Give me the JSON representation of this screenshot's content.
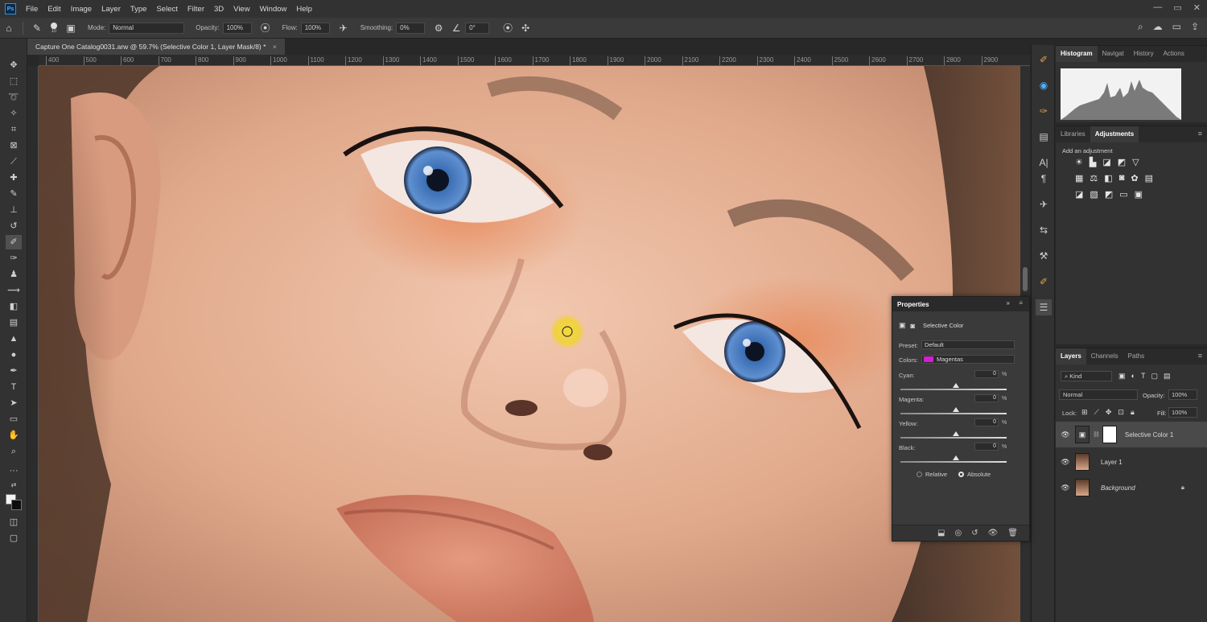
{
  "menubar": {
    "logo": "Ps",
    "items": [
      "File",
      "Edit",
      "Image",
      "Layer",
      "Type",
      "Select",
      "Filter",
      "3D",
      "View",
      "Window",
      "Help"
    ],
    "window_controls": [
      "—",
      "▭",
      "✕"
    ]
  },
  "options": {
    "brush_size": "10",
    "mode_label": "Mode:",
    "mode_value": "Normal",
    "opacity_label": "Opacity:",
    "opacity_value": "100%",
    "flow_label": "Flow:",
    "flow_value": "100%",
    "smoothing_label": "Smoothing:",
    "smoothing_value": "0%",
    "angle_value": "0°"
  },
  "document": {
    "tab_title": "Capture One Catalog0031.arw @ 59.7% (Selective Color 1, Layer Mask/8) *",
    "close": "×"
  },
  "ruler": {
    "ticks": [
      "400",
      "500",
      "600",
      "700",
      "800",
      "900",
      "1000",
      "1100",
      "1200",
      "1300",
      "1400",
      "1500",
      "1600",
      "1700",
      "1800",
      "1900",
      "2000",
      "2100",
      "2200",
      "2300",
      "2400",
      "2500",
      "2600",
      "2700",
      "2800",
      "2900"
    ]
  },
  "histogram_panel": {
    "tabs": [
      "Histogram",
      "Navigat",
      "History",
      "Actions"
    ],
    "active": "Histogram",
    "warning": "⚠"
  },
  "adjustments_panel": {
    "tabs": [
      "Libraries",
      "Adjustments"
    ],
    "active": "Adjustments",
    "hint": "Add an adjustment"
  },
  "properties": {
    "title": "Properties",
    "layer_type": "Selective Color",
    "preset_label": "Preset:",
    "preset_value": "Default",
    "colors_label": "Colors:",
    "colors_value": "Magentas",
    "colors_swatch": "#d21fd2",
    "sliders": [
      {
        "label": "Cyan:",
        "value": "0",
        "unit": "%"
      },
      {
        "label": "Magenta:",
        "value": "0",
        "unit": "%"
      },
      {
        "label": "Yellow:",
        "value": "0",
        "unit": "%"
      },
      {
        "label": "Black:",
        "value": "0",
        "unit": "%"
      }
    ],
    "method_relative": "Relative",
    "method_absolute": "Absolute",
    "method_selected": "Absolute"
  },
  "layers_panel": {
    "tabs": [
      "Layers",
      "Channels",
      "Paths"
    ],
    "active": "Layers",
    "kind_label": "Kind",
    "blend_mode": "Normal",
    "opacity_label": "Opacity:",
    "opacity_value": "100%",
    "lock_label": "Lock:",
    "fill_label": "Fill:",
    "fill_value": "100%",
    "layers": [
      {
        "name": "Selective Color 1",
        "selected": true
      },
      {
        "name": "Layer 1",
        "selected": false
      },
      {
        "name": "Background",
        "selected": false,
        "locked": true
      }
    ]
  },
  "colors": {
    "app_bg": "#282828",
    "panel_bg": "#323232",
    "accent_cursor": "#f0d23a"
  }
}
